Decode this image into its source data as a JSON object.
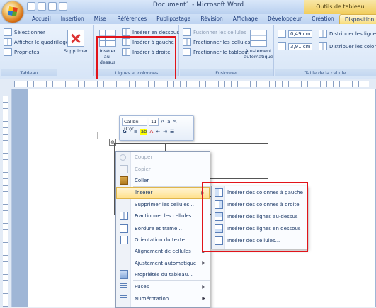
{
  "window": {
    "title": "Document1 - Microsoft Word",
    "context_title": "Outils de tableau"
  },
  "ribbon_tabs": [
    "Accueil",
    "Insertion",
    "Mise en page",
    "Références",
    "Publipostage",
    "Révision",
    "Affichage",
    "Développeur",
    "Création",
    "Disposition"
  ],
  "ribbon": {
    "table_group": {
      "items": [
        "Sélectionner",
        "Afficher le quadrillage",
        "Propriétés"
      ],
      "label": "Tableau"
    },
    "delete_button": "Supprimer",
    "insert_above_button": "Insérer au-dessus",
    "rows_cols": {
      "items": [
        "Insérer en dessous",
        "Insérer à gauche",
        "Insérer à droite"
      ],
      "label": "Lignes et colonnes"
    },
    "merge": {
      "items": [
        "Fusionner les cellules",
        "Fractionner les cellules",
        "Fractionner le tableau"
      ],
      "label": "Fusionner"
    },
    "autofit_button": "Ajustement automatique",
    "cell_size": {
      "height": "0,49 cm",
      "width": "3,91 cm",
      "label": "Taille de la cellule"
    },
    "distribute": [
      "Distribuer les lignes",
      "Distribuer les colonnes"
    ]
  },
  "mini_toolbar": {
    "font": "Calibri (Cor",
    "size": "11"
  },
  "context_menu": {
    "items": [
      {
        "label": "Couper",
        "icon": "scissors-icon",
        "disabled": true
      },
      {
        "label": "Copier",
        "icon": "copy-icon",
        "disabled": true
      },
      {
        "label": "Coller",
        "icon": "paste-icon",
        "disabled": false
      },
      {
        "label": "Insérer",
        "icon": "",
        "disabled": false,
        "submenu": true,
        "highlighted": true
      },
      {
        "label": "Supprimer les cellules...",
        "icon": "",
        "disabled": false
      },
      {
        "label": "Fractionner les cellules...",
        "icon": "split-cells-icon",
        "disabled": false
      },
      {
        "label": "Bordure et trame...",
        "icon": "borders-icon",
        "disabled": false
      },
      {
        "label": "Orientation du texte...",
        "icon": "text-direction-icon",
        "disabled": false
      },
      {
        "label": "Alignement de cellules",
        "icon": "",
        "disabled": false,
        "submenu": true
      },
      {
        "label": "Ajustement automatique",
        "icon": "",
        "disabled": false,
        "submenu": true
      },
      {
        "label": "Propriétés du tableau...",
        "icon": "table-properties-icon",
        "disabled": false
      },
      {
        "label": "Puces",
        "icon": "bullets-icon",
        "disabled": false,
        "submenu": true
      },
      {
        "label": "Numérotation",
        "icon": "numbering-icon",
        "disabled": false,
        "submenu": true
      }
    ]
  },
  "submenu": {
    "items": [
      "Insérer des colonnes à gauche",
      "Insérer des colonnes à droite",
      "Insérer des lignes au-dessus",
      "Insérer des lignes en dessous",
      "Insérer des cellules..."
    ]
  }
}
